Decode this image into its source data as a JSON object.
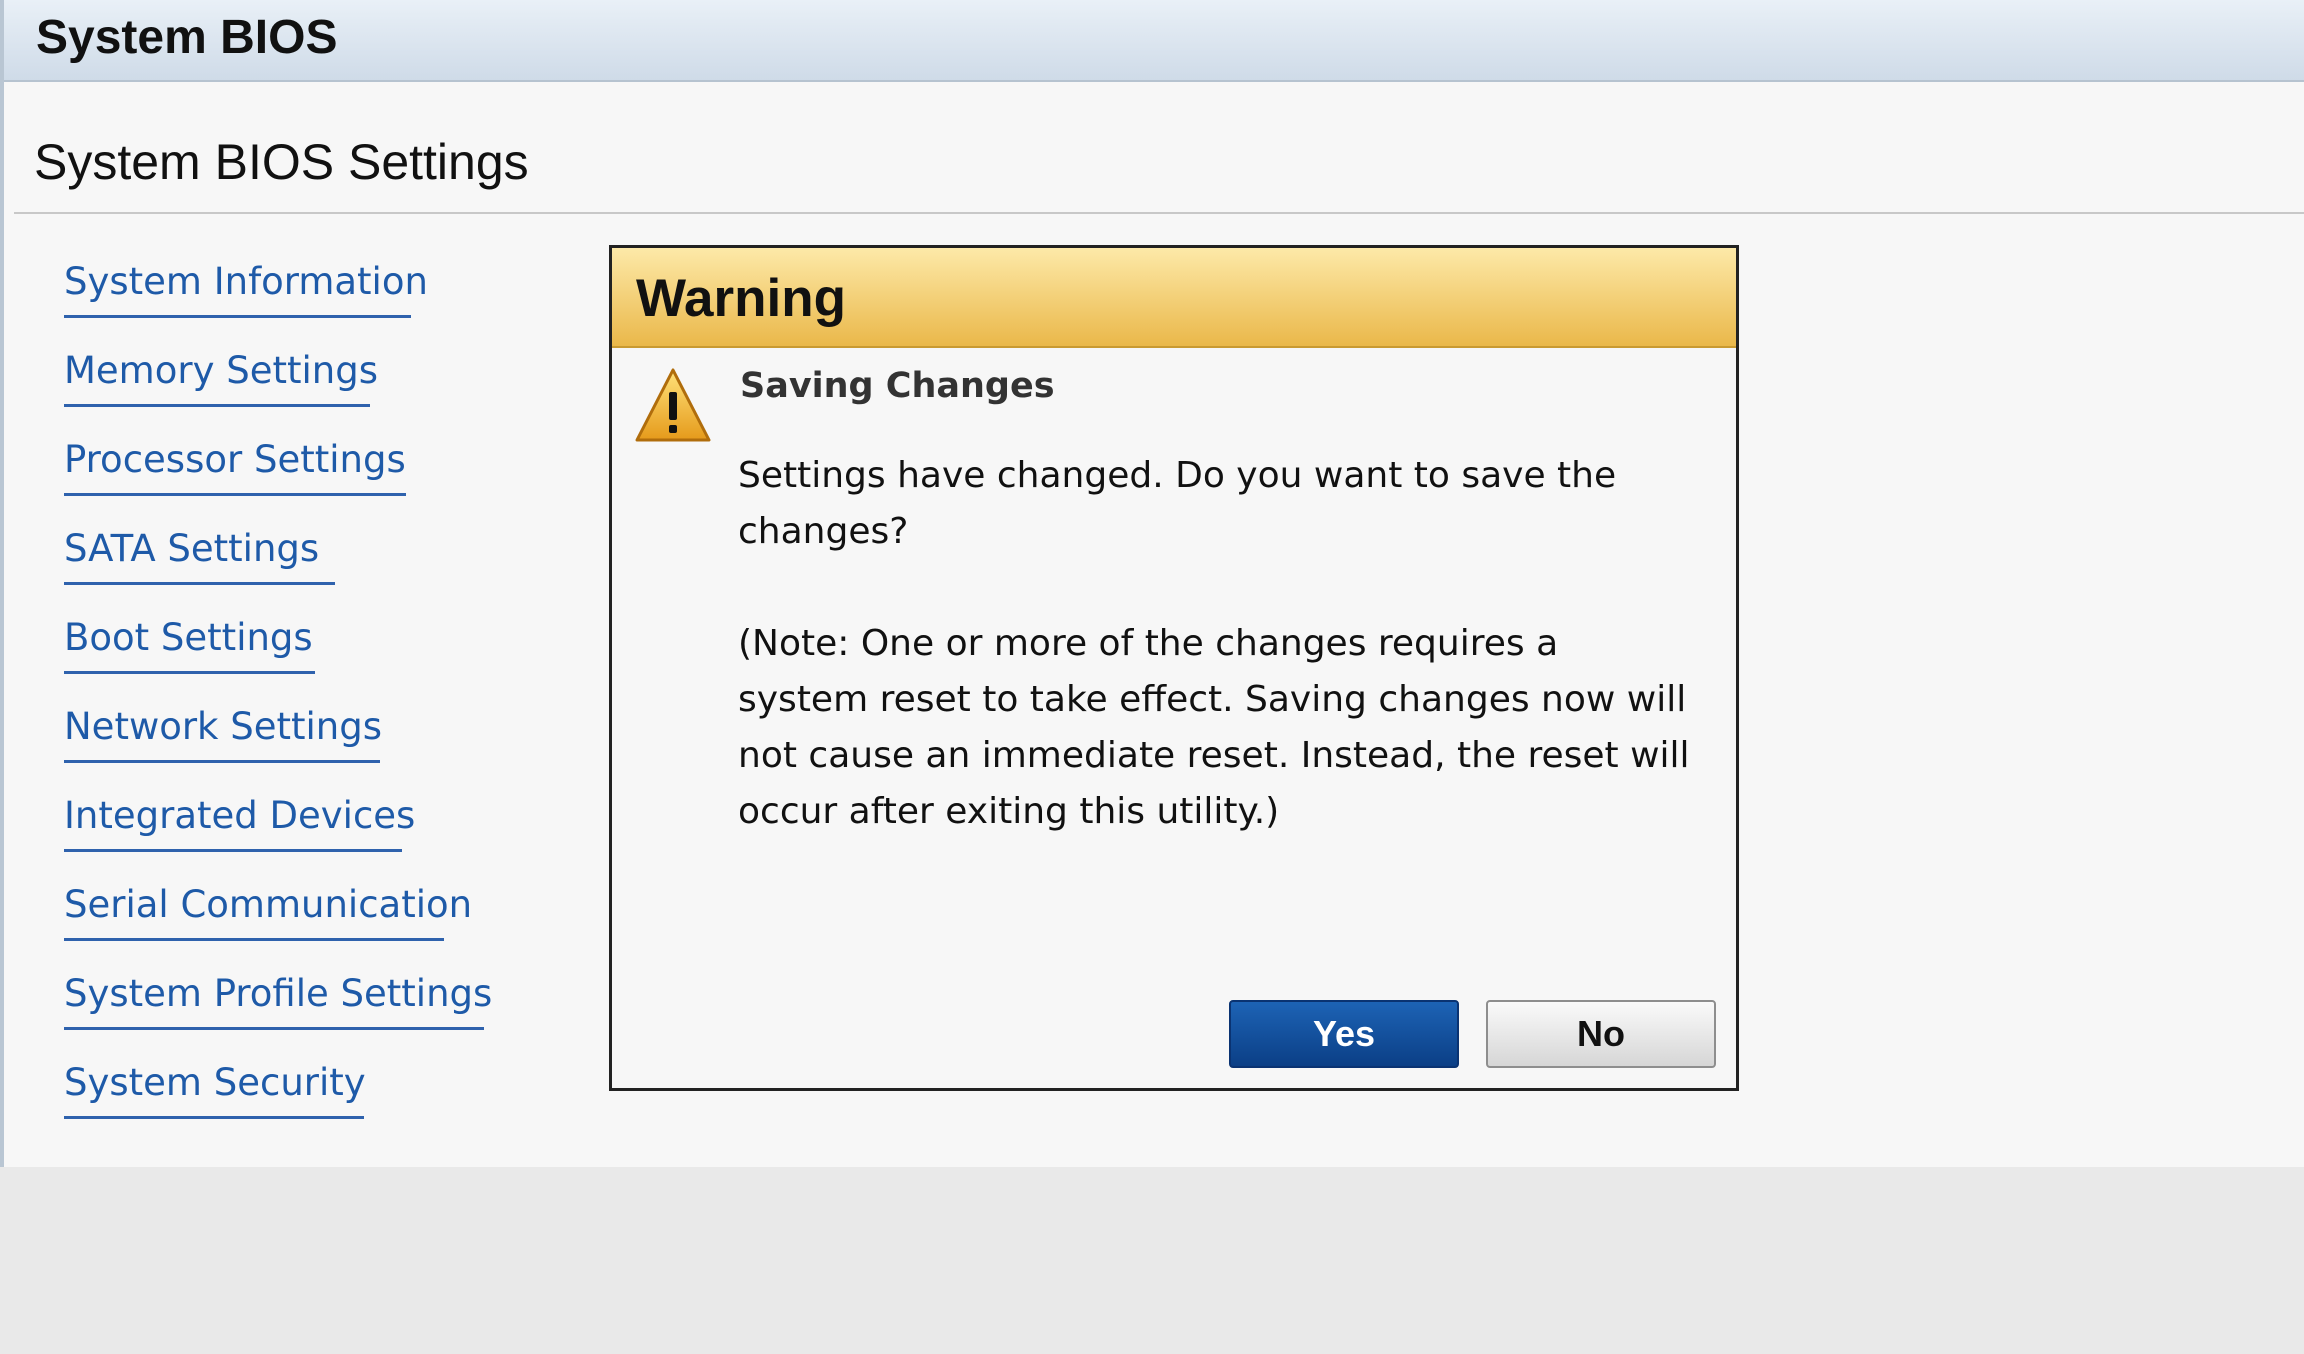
{
  "header": {
    "title": "System BIOS"
  },
  "page": {
    "title": "System BIOS Settings"
  },
  "nav": {
    "items": [
      {
        "label": "System Information"
      },
      {
        "label": "Memory Settings"
      },
      {
        "label": "Processor Settings"
      },
      {
        "label": "SATA Settings"
      },
      {
        "label": "Boot Settings"
      },
      {
        "label": "Network Settings"
      },
      {
        "label": "Integrated Devices"
      },
      {
        "label": "Serial Communication"
      },
      {
        "label": "System Profile Settings"
      },
      {
        "label": "System Security"
      }
    ]
  },
  "dialog": {
    "title": "Warning",
    "icon": "warning-icon",
    "heading": "Saving Changes",
    "message": "Settings have changed. Do you want to save the changes?",
    "note": "(Note: One or more of the changes requires a system reset to take effect. Saving changes now will not cause an immediate reset. Instead, the reset will occur after exiting this utility.)",
    "yes_label": "Yes",
    "no_label": "No"
  },
  "colors": {
    "link": "#1e5aa8",
    "header_bg": "#cfdbe8",
    "dialog_header": "#eab84a",
    "primary_button": "#0b4a99"
  }
}
